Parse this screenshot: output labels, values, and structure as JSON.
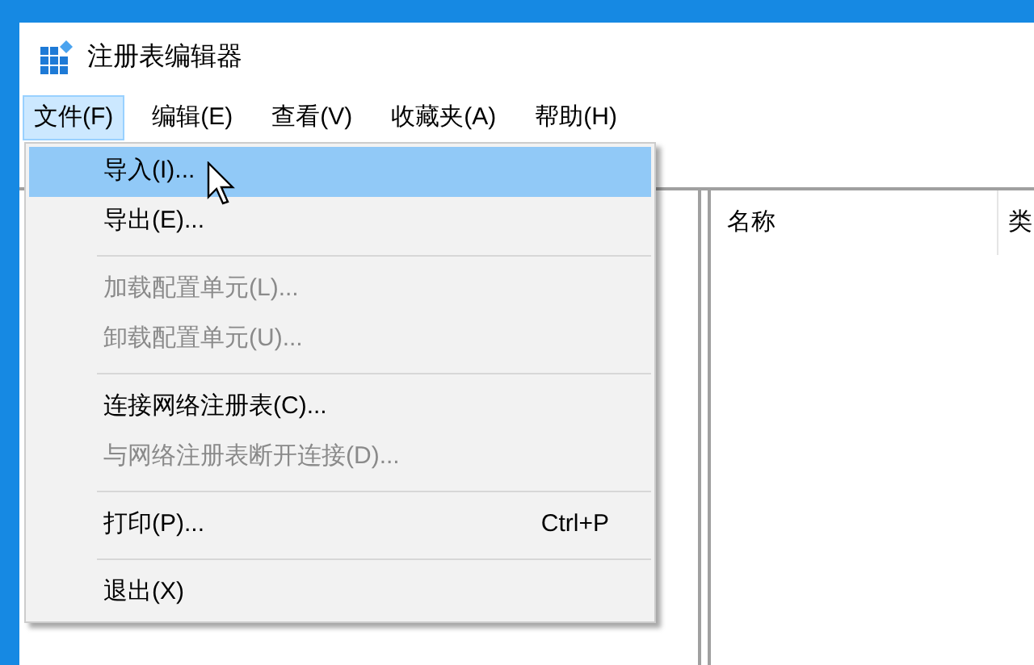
{
  "window": {
    "title": "注册表编辑器"
  },
  "menu_bar": [
    {
      "label": "文件(F)",
      "selected": true
    },
    {
      "label": "编辑(E)",
      "selected": false
    },
    {
      "label": "查看(V)",
      "selected": false
    },
    {
      "label": "收藏夹(A)",
      "selected": false
    },
    {
      "label": "帮助(H)",
      "selected": false
    }
  ],
  "file_menu": [
    {
      "kind": "item",
      "label": "导入(I)...",
      "selected": true,
      "disabled": false
    },
    {
      "kind": "item",
      "label": "导出(E)...",
      "selected": false,
      "disabled": false
    },
    {
      "kind": "separator"
    },
    {
      "kind": "item",
      "label": "加载配置单元(L)...",
      "selected": false,
      "disabled": true
    },
    {
      "kind": "item",
      "label": "卸载配置单元(U)...",
      "selected": false,
      "disabled": true
    },
    {
      "kind": "separator"
    },
    {
      "kind": "item",
      "label": "连接网络注册表(C)...",
      "selected": false,
      "disabled": false
    },
    {
      "kind": "item",
      "label": "与网络注册表断开连接(D)...",
      "selected": false,
      "disabled": true
    },
    {
      "kind": "separator"
    },
    {
      "kind": "item",
      "label": "打印(P)...",
      "shortcut": "Ctrl+P",
      "selected": false,
      "disabled": false
    },
    {
      "kind": "separator"
    },
    {
      "kind": "item",
      "label": "退出(X)",
      "selected": false,
      "disabled": false
    }
  ],
  "list_view": {
    "columns": [
      "名称",
      "类"
    ]
  }
}
